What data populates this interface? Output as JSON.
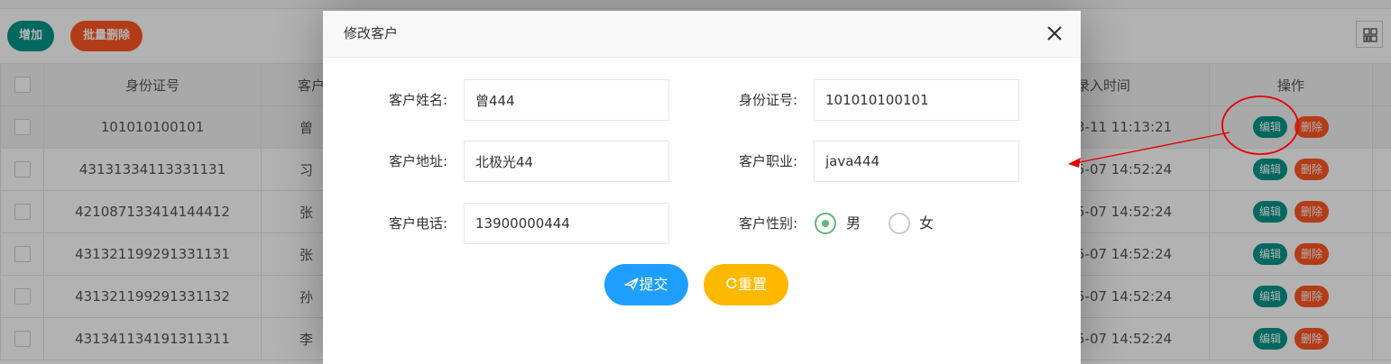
{
  "toolbar": {
    "add_label": "增加",
    "batch_delete_label": "批量删除"
  },
  "table": {
    "headers": {
      "id_card": "身份证号",
      "name": "客户",
      "time": "录入时间",
      "ops": "操作"
    },
    "rows": [
      {
        "id_card": "101010100101",
        "name": "曾",
        "time": "3-11 11:13:21"
      },
      {
        "id_card": "43131334113331131",
        "name": "习",
        "time": "5-07 14:52:24"
      },
      {
        "id_card": "421087133414144412",
        "name": "张",
        "time": "5-07 14:52:24"
      },
      {
        "id_card": "431321199291331131",
        "name": "张",
        "time": "5-07 14:52:24"
      },
      {
        "id_card": "431321199291331132",
        "name": "孙",
        "time": "5-07 14:52:24"
      },
      {
        "id_card": "431341134191311311",
        "name": "李",
        "time": "5-07 14:52:24"
      }
    ],
    "edit_label": "编辑",
    "delete_label": "删除"
  },
  "modal": {
    "title": "修改客户",
    "fields": {
      "name": {
        "label": "客户姓名:",
        "value": "曾444"
      },
      "id_card": {
        "label": "身份证号:",
        "value": "101010100101"
      },
      "address": {
        "label": "客户地址:",
        "value": "北极光44"
      },
      "job": {
        "label": "客户职业:",
        "value": "java444"
      },
      "phone": {
        "label": "客户电话:",
        "value": "13900000444"
      },
      "gender": {
        "label": "客户性别:",
        "male": "男",
        "female": "女",
        "selected": "男"
      }
    },
    "submit_label": "提交",
    "reset_label": "重置"
  },
  "colors": {
    "edit": "#009688",
    "delete": "#FF5722",
    "submit": "#1E9FFF",
    "reset": "#FFB800",
    "radio_checked": "#5FB878",
    "annotation": "#e60000"
  }
}
